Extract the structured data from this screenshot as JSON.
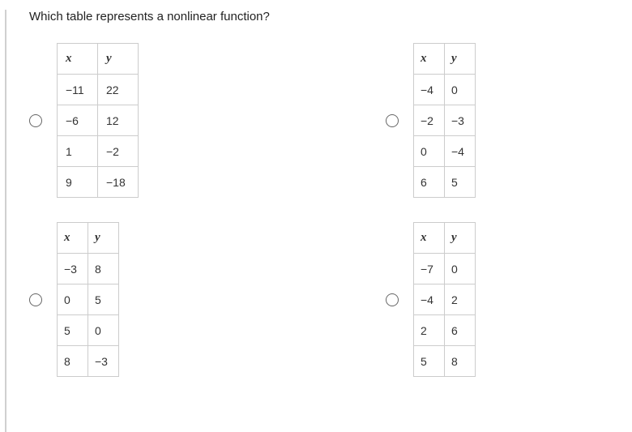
{
  "question": "Which table represents a nonlinear function?",
  "headers": {
    "x": "x",
    "y": "y"
  },
  "options": [
    {
      "id": "a",
      "rows": [
        {
          "x": "−11",
          "y": "22"
        },
        {
          "x": "−6",
          "y": "12"
        },
        {
          "x": "1",
          "y": "−2"
        },
        {
          "x": "9",
          "y": "−18"
        }
      ]
    },
    {
      "id": "b",
      "rows": [
        {
          "x": "−4",
          "y": "0"
        },
        {
          "x": "−2",
          "y": "−3"
        },
        {
          "x": "0",
          "y": "−4"
        },
        {
          "x": "6",
          "y": "5"
        }
      ]
    },
    {
      "id": "c",
      "rows": [
        {
          "x": "−3",
          "y": "8"
        },
        {
          "x": "0",
          "y": "5"
        },
        {
          "x": "5",
          "y": "0"
        },
        {
          "x": "8",
          "y": "−3"
        }
      ]
    },
    {
      "id": "d",
      "rows": [
        {
          "x": "−7",
          "y": "0"
        },
        {
          "x": "−4",
          "y": "2"
        },
        {
          "x": "2",
          "y": "6"
        },
        {
          "x": "5",
          "y": "8"
        }
      ]
    }
  ]
}
